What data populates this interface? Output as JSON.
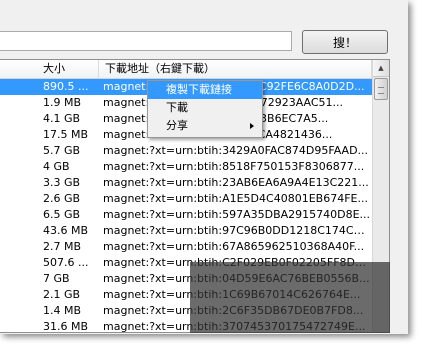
{
  "search": {
    "value": "",
    "button_label": "搜！"
  },
  "table": {
    "columns": [
      "大小",
      "下載地址（右鍵下載）"
    ],
    "rows": [
      {
        "size": "890.5 ...",
        "link": "magnet:?xt=urn:btih:C2A1CC92FE6C8A0D2D..."
      },
      {
        "size": "1.9 MB",
        "link": "magnet:?xt=urn:btih:9DD5C72923AAC51..."
      },
      {
        "size": "4.1 GB",
        "link": "magnet:?xt=urn:btih:2DD313B6EC7A5..."
      },
      {
        "size": "17.5 MB",
        "link": "magnet:?xt=urn:btih:9C7E1CA4821436..."
      },
      {
        "size": "5.7 GB",
        "link": "magnet:?xt=urn:btih:3429A0FAC874D95FAAD..."
      },
      {
        "size": "4 GB",
        "link": "magnet:?xt=urn:btih:8518F750153F8306877..."
      },
      {
        "size": "3.3 GB",
        "link": "magnet:?xt=urn:btih:23AB6EA6A9A4E13C221..."
      },
      {
        "size": "2.6 GB",
        "link": "magnet:?xt=urn:btih:A1E5D4C40801EB674FE..."
      },
      {
        "size": "6.5 GB",
        "link": "magnet:?xt=urn:btih:597A35DBA2915740D8E..."
      },
      {
        "size": "43.6 MB",
        "link": "magnet:?xt=urn:btih:97C96B0DD1218C174C1..."
      },
      {
        "size": "2.7 MB",
        "link": "magnet:?xt=urn:btih:67A865962510368A40F..."
      },
      {
        "size": "507.6 ...",
        "link": "magnet:?xt=urn:btih:C2F029EB0F02205FF8DB..."
      },
      {
        "size": "7 GB",
        "link": "magnet:?xt=urn:btih:04D59E6AC76BEB0556B..."
      },
      {
        "size": "2.1 GB",
        "link": "magnet:?xt=urn:btih:1C69B67014C626764E..."
      },
      {
        "size": "1.4 MB",
        "link": "magnet:?xt=urn:btih:2C6F35DB67DE0B7FD8..."
      },
      {
        "size": "31.6 MB",
        "link": "magnet:?xt=urn:btih:370745370175472749E..."
      }
    ]
  },
  "context_menu": {
    "items": [
      "複製下載鏈接",
      "下載",
      "分享"
    ]
  },
  "colors": {
    "selection": "#3399ff",
    "window_bg": "#f0f0f0",
    "overlay": "#323232"
  }
}
